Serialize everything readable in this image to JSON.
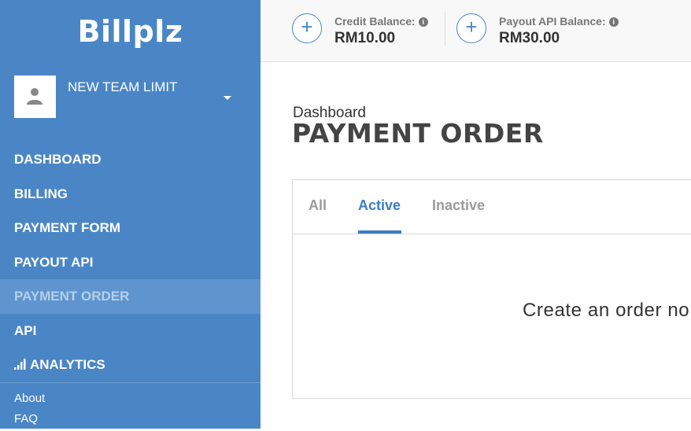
{
  "app": {
    "logo": "Billplz"
  },
  "team": {
    "name": "NEW TEAM LIMIT",
    "avatar_icon": "person-icon",
    "dropdown_icon": "caret-down-icon"
  },
  "sidebar": {
    "items": [
      {
        "label": "DASHBOARD",
        "active": false
      },
      {
        "label": "BILLING",
        "active": false
      },
      {
        "label": "PAYMENT FORM",
        "active": false
      },
      {
        "label": "PAYOUT API",
        "active": false
      },
      {
        "label": "PAYMENT ORDER",
        "active": true
      },
      {
        "label": "API",
        "active": false
      },
      {
        "label": "ANALYTICS",
        "active": false,
        "icon": "bar-chart-icon"
      }
    ],
    "footer": [
      "About",
      "FAQ"
    ]
  },
  "topbar": {
    "credit": {
      "label": "Credit Balance:",
      "value": "RM10.00",
      "icon": "plus-icon",
      "info_icon": "info-icon"
    },
    "payout": {
      "label": "Payout API Balance:",
      "value": "RM30.00",
      "icon": "plus-icon",
      "info_icon": "info-icon"
    }
  },
  "main": {
    "breadcrumb": "Dashboard",
    "title": "PAYMENT ORDER",
    "tabs": [
      {
        "label": "All",
        "active": false
      },
      {
        "label": "Active",
        "active": true
      },
      {
        "label": "Inactive",
        "active": false
      }
    ],
    "empty_message": "Create an order no"
  },
  "colors": {
    "sidebar": "#4a86c5",
    "active_item": "#5f95ce",
    "accent": "#3a7ec2"
  }
}
